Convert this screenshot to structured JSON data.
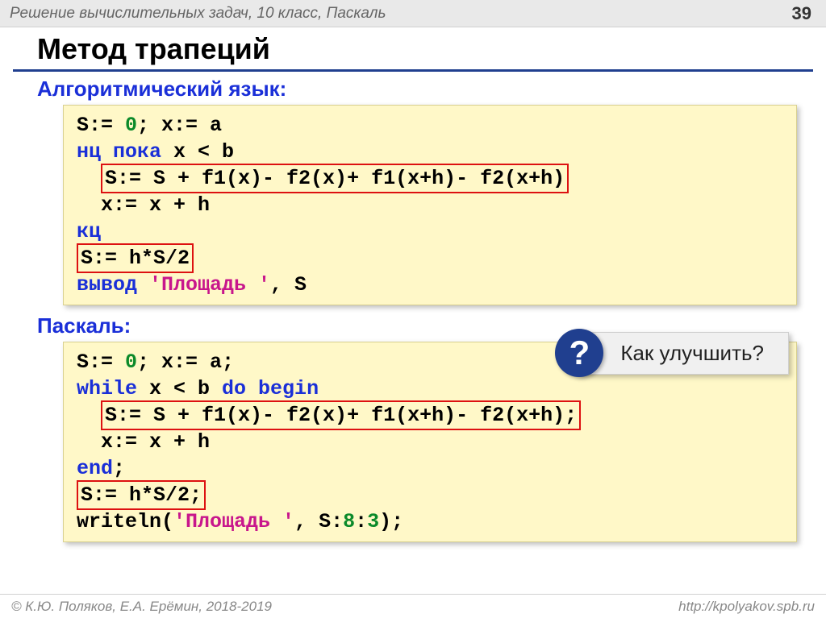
{
  "topbar": {
    "title": "Решение  вычислительных задач, 10 класс, Паскаль",
    "page": "39"
  },
  "heading": "Метод трапеций",
  "section1": {
    "label": "Алгоритмический язык:",
    "code": {
      "l1a": "S:= ",
      "l1_zero": "0",
      "l1b": "; x:= a",
      "l2a": "нц пока",
      "l2b": " x < b",
      "l3": "S:= S + f1(x)- f2(x)+ f1(x+h)- f2(x+h)",
      "l4": "  x:= x + h",
      "l5": "кц",
      "l6": "S:= h*S/2",
      "l7a": "вывод ",
      "l7_str": "'Площадь '",
      "l7b": ", S"
    }
  },
  "section2": {
    "label": "Паскаль:",
    "code": {
      "l1a": "S:= ",
      "l1_zero": "0",
      "l1b": "; x:= a;",
      "l2a": "while",
      "l2b": " x < b ",
      "l2c": "do begin",
      "l3": "S:= S + f1(x)- f2(x)+ f1(x+h)- f2(x+h);",
      "l4": "  x:= x + h",
      "l5": "end",
      "l5b": ";",
      "l6": "S:= h*S/2;",
      "l7a": "writeln(",
      "l7_str": "'Площадь '",
      "l7b": ", S:",
      "l7_n1": "8",
      "l7c": ":",
      "l7_n2": "3",
      "l7d": ");"
    }
  },
  "callout": {
    "q": "?",
    "text": "Как улучшить?"
  },
  "footer": {
    "left": "© К.Ю. Поляков, Е.А. Ерёмин, 2018-2019",
    "right": "http://kpolyakov.spb.ru"
  }
}
